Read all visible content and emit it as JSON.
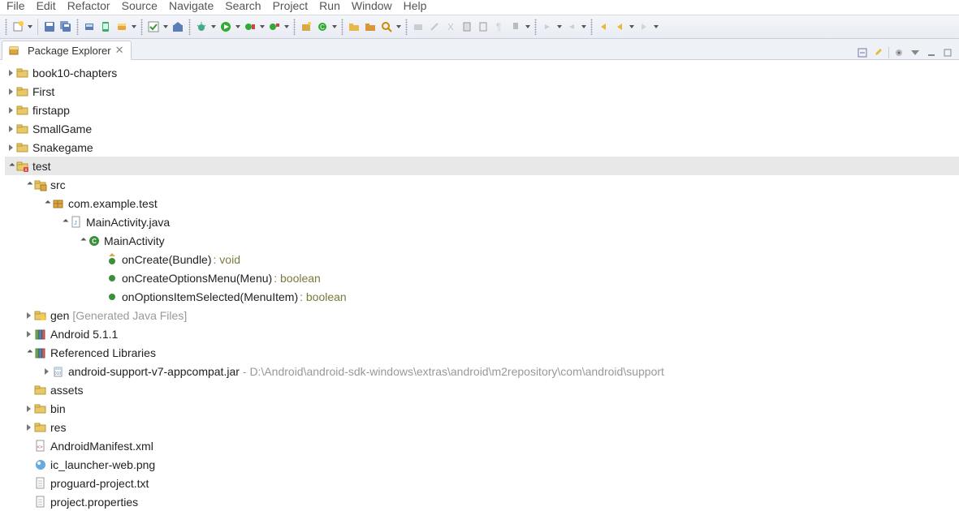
{
  "menu": [
    "File",
    "Edit",
    "Refactor",
    "Source",
    "Navigate",
    "Search",
    "Project",
    "Run",
    "Window",
    "Help"
  ],
  "view": {
    "tab_title": "Package Explorer"
  },
  "tree": [
    {
      "depth": 0,
      "arrow": "collapsed",
      "icon": "project",
      "label": "book10-chapters"
    },
    {
      "depth": 0,
      "arrow": "collapsed",
      "icon": "project",
      "label": "First"
    },
    {
      "depth": 0,
      "arrow": "collapsed",
      "icon": "project",
      "label": "firstapp"
    },
    {
      "depth": 0,
      "arrow": "collapsed",
      "icon": "project",
      "label": "SmallGame"
    },
    {
      "depth": 0,
      "arrow": "collapsed",
      "icon": "project",
      "label": "Snakegame"
    },
    {
      "depth": 0,
      "arrow": "expanded",
      "icon": "project-err",
      "label": "test",
      "selected": true
    },
    {
      "depth": 1,
      "arrow": "expanded",
      "icon": "src",
      "label": "src"
    },
    {
      "depth": 2,
      "arrow": "expanded",
      "icon": "package",
      "label": "com.example.test"
    },
    {
      "depth": 3,
      "arrow": "expanded",
      "icon": "java",
      "label": "MainActivity.java"
    },
    {
      "depth": 4,
      "arrow": "expanded",
      "icon": "class",
      "label": "MainActivity"
    },
    {
      "depth": 5,
      "arrow": "none",
      "icon": "method-ov",
      "label": "onCreate(Bundle)",
      "type": ": void"
    },
    {
      "depth": 5,
      "arrow": "none",
      "icon": "method",
      "label": "onCreateOptionsMenu(Menu)",
      "type": ": boolean"
    },
    {
      "depth": 5,
      "arrow": "none",
      "icon": "method",
      "label": "onOptionsItemSelected(MenuItem)",
      "type": ": boolean"
    },
    {
      "depth": 1,
      "arrow": "collapsed",
      "icon": "gen",
      "label": "gen",
      "decor": "[Generated Java Files]"
    },
    {
      "depth": 1,
      "arrow": "collapsed",
      "icon": "lib",
      "label": "Android 5.1.1"
    },
    {
      "depth": 1,
      "arrow": "expanded",
      "icon": "lib",
      "label": "Referenced Libraries"
    },
    {
      "depth": 2,
      "arrow": "collapsed",
      "icon": "jar",
      "label": "android-support-v7-appcompat.jar",
      "decor": "- D:\\Android\\android-sdk-windows\\extras\\android\\m2repository\\com\\android\\support"
    },
    {
      "depth": 1,
      "arrow": "none",
      "icon": "folder",
      "label": "assets"
    },
    {
      "depth": 1,
      "arrow": "collapsed",
      "icon": "folder",
      "label": "bin"
    },
    {
      "depth": 1,
      "arrow": "collapsed",
      "icon": "folder",
      "label": "res"
    },
    {
      "depth": 1,
      "arrow": "none",
      "icon": "xml",
      "label": "AndroidManifest.xml"
    },
    {
      "depth": 1,
      "arrow": "none",
      "icon": "img",
      "label": "ic_launcher-web.png"
    },
    {
      "depth": 1,
      "arrow": "none",
      "icon": "txt",
      "label": "proguard-project.txt"
    },
    {
      "depth": 1,
      "arrow": "none",
      "icon": "txt",
      "label": "project.properties"
    }
  ]
}
